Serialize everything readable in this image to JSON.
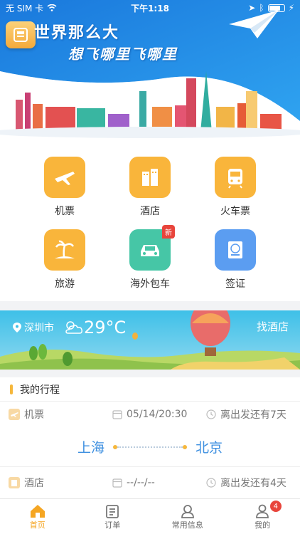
{
  "status_bar": {
    "carrier": "无 SIM 卡",
    "time": "下午1:18"
  },
  "hero": {
    "title_line1": "世界那么大",
    "title_line2": "想飞哪里飞哪里"
  },
  "services": [
    {
      "label": "机票",
      "icon": "plane-icon",
      "color": "#f9b53b"
    },
    {
      "label": "酒店",
      "icon": "hotel-icon",
      "color": "#f9b53b"
    },
    {
      "label": "火车票",
      "icon": "train-icon",
      "color": "#f9b53b"
    },
    {
      "label": "旅游",
      "icon": "beach-icon",
      "color": "#f9b53b"
    },
    {
      "label": "海外包车",
      "icon": "car-icon",
      "color": "#46c6a6",
      "badge": "新"
    },
    {
      "label": "签证",
      "icon": "visa-icon",
      "color": "#5b9df1"
    }
  ],
  "weather": {
    "city": "深圳市",
    "temperature": "29°C",
    "link": "找酒店"
  },
  "trips": {
    "title": "我的行程",
    "items": [
      {
        "type": "机票",
        "date": "05/14/20:30",
        "remaining": "离出发还有7天",
        "from": "上海",
        "to": "北京"
      },
      {
        "type": "酒店",
        "date": "--/--/--",
        "remaining": "离出发还有4天"
      }
    ]
  },
  "tabbar": {
    "items": [
      {
        "label": "首页",
        "active": true
      },
      {
        "label": "订单",
        "active": false
      },
      {
        "label": "常用信息",
        "active": false
      },
      {
        "label": "我的",
        "active": false,
        "badge": "4"
      }
    ]
  },
  "colors": {
    "accent": "#f5a623",
    "sky_blue": "#1d8be6",
    "route_blue": "#3d8fe0"
  }
}
